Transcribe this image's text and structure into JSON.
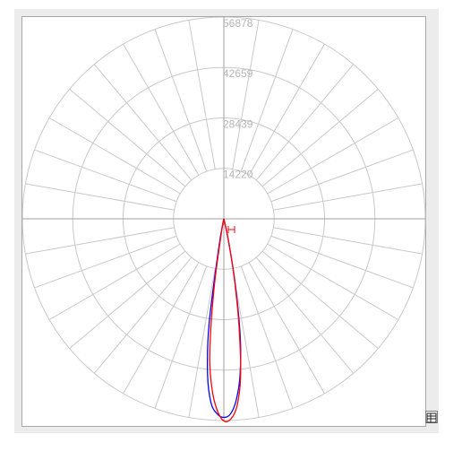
{
  "chart_data": {
    "type": "polar",
    "title": "",
    "radial_ticks": [
      14220,
      28439,
      42659,
      56878
    ],
    "radial_max": 56878,
    "angle_step_deg": 10,
    "angle_zero": "down",
    "grid": true,
    "series": [
      {
        "color": "#0000ff",
        "angles_deg": [
          -10,
          -8,
          -6,
          -4,
          -2,
          0,
          2,
          4,
          6,
          8,
          10,
          12
        ],
        "values": [
          8000,
          30000,
          44000,
          52000,
          55000,
          56000,
          55000,
          51000,
          44000,
          33000,
          18000,
          6000
        ]
      },
      {
        "color": "#ff0000",
        "angles_deg": [
          -10,
          -8,
          -6,
          -4,
          -2,
          0,
          2,
          4,
          6,
          8,
          10,
          12
        ],
        "values": [
          4000,
          20000,
          38000,
          48000,
          54000,
          57000,
          56500,
          53000,
          45000,
          31000,
          17000,
          6000
        ]
      }
    ]
  },
  "colors": {
    "grid": "#c8c8c8",
    "axis": "#a0a0a0",
    "tick_text": "#b5b5b5"
  },
  "icons": {
    "corner": "table-icon"
  }
}
